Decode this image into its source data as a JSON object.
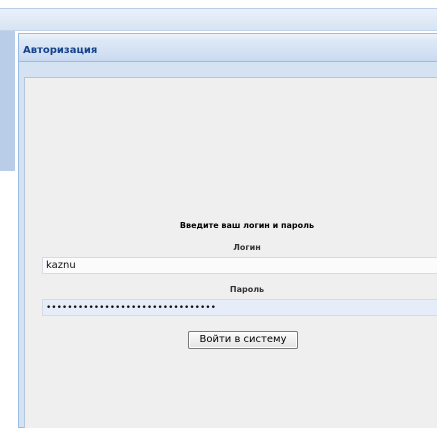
{
  "panel": {
    "title": "Авторизация"
  },
  "login_form": {
    "prompt": "Введите ваш логин и пароль",
    "login_label": "Логин",
    "login_value": "kaznu",
    "password_label": "Пароль",
    "password_value": "••••••••••••••••••••••••••••••••",
    "submit_label": "Войти в систему"
  },
  "colors": {
    "accent_blue": "#99bbe8",
    "title_text": "#15428b",
    "body_background": "#efefef",
    "password_field_background": "#e6edf8"
  }
}
